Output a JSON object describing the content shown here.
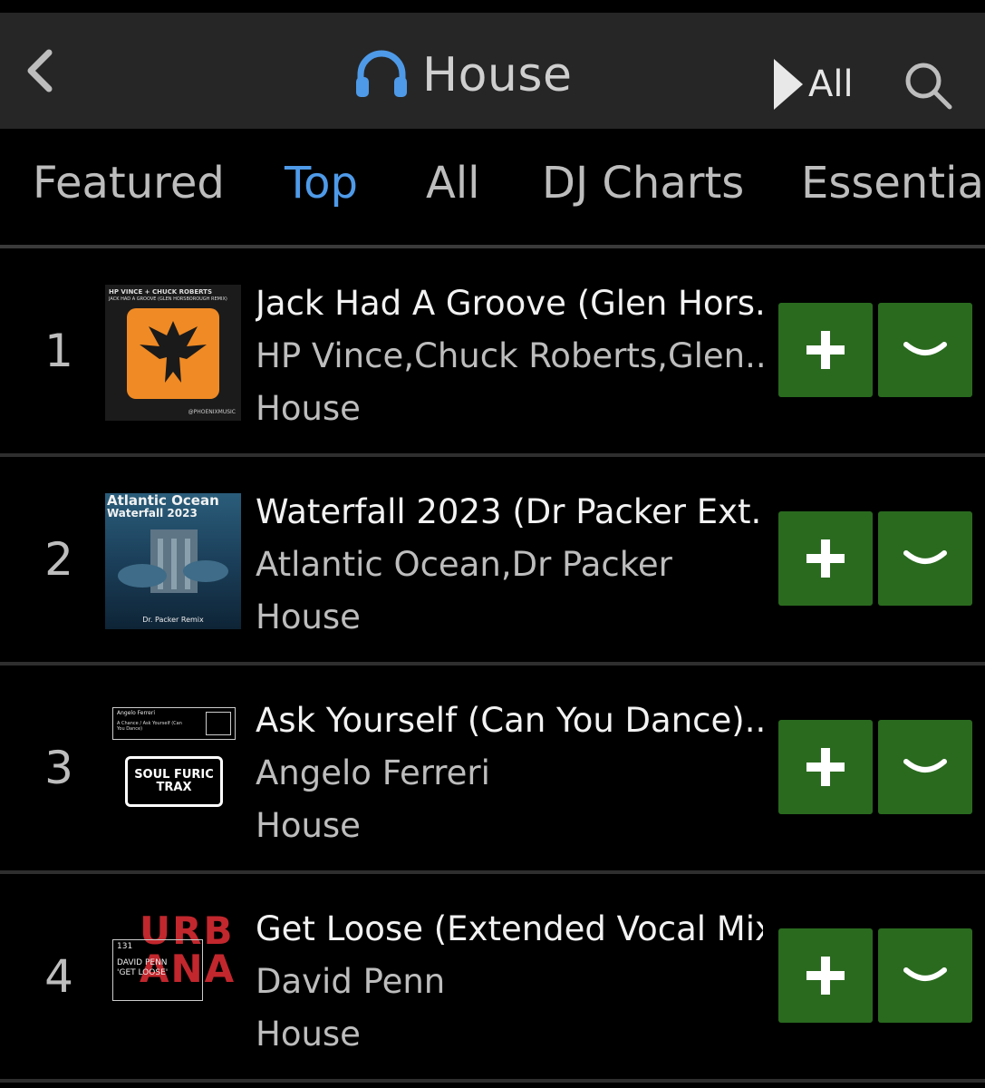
{
  "header": {
    "title": "House",
    "play_all_label": "All"
  },
  "tabs": [
    {
      "label": "Featured",
      "active": false
    },
    {
      "label": "Top",
      "active": true
    },
    {
      "label": "All",
      "active": false
    },
    {
      "label": "DJ Charts",
      "active": false
    },
    {
      "label": "Essential",
      "active": false
    }
  ],
  "tracks": [
    {
      "rank": "1",
      "title": "Jack Had A Groove (Glen Hors...",
      "artists": "HP Vince,Chuck Roberts,Glen...",
      "genre": "House",
      "art": {
        "line1": "HP VINCE + CHUCK ROBERTS",
        "line2": "JACK HAD A GROOVE (GLEN HORSBOROUGH REMIX)",
        "label": "@PHOENIXMUSIC"
      }
    },
    {
      "rank": "2",
      "title": "Waterfall 2023 (Dr Packer Ext...",
      "artists": "Atlantic Ocean,Dr Packer",
      "genre": "House",
      "art": {
        "line1": "Atlantic Ocean",
        "line2": "Waterfall 2023",
        "label": "Dr. Packer Remix"
      }
    },
    {
      "rank": "3",
      "title": "Ask Yourself (Can You Dance)...",
      "artists": "Angelo Ferreri",
      "genre": "House",
      "art": {
        "line1": "Angelo Ferreri",
        "line2": "A Chance / Ask Yourself (Can You Dance)",
        "label": "SOUL FURIC TRAX"
      }
    },
    {
      "rank": "4",
      "title": "Get Loose (Extended Vocal Mix)",
      "artists": "David Penn",
      "genre": "House",
      "art": {
        "line1": "131",
        "line2": "DAVID PENN 'GET LOOSE'",
        "label": "URBANA"
      }
    }
  ],
  "colors": {
    "background": "#000000",
    "topbar": "#262626",
    "accent_blue": "#4e9ae8",
    "button_green": "#2a6a1f"
  },
  "icons": {
    "back": "chevron-left-icon",
    "genre": "headphones-icon",
    "play": "play-icon",
    "search": "search-icon",
    "add": "plus-icon",
    "more": "chevron-down-icon"
  }
}
